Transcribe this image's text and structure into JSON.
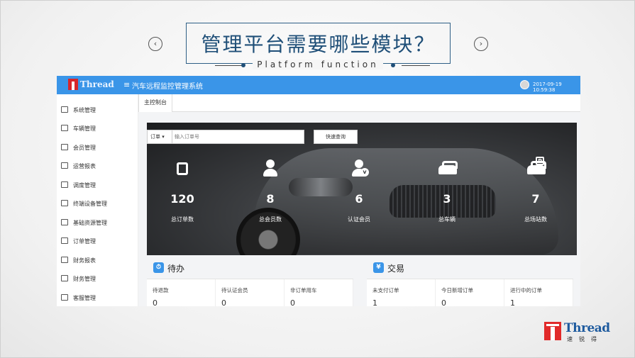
{
  "slide": {
    "title": "管理平台需要哪些模块？",
    "subtitle": "Platform function",
    "prev_arrow": "‹",
    "next_arrow": "›"
  },
  "app": {
    "logo_text": "Thread",
    "menu_icon": "≡",
    "title": "汽车远程监控管理系统",
    "datetime": "2017-09-19 10:59:38",
    "accent_color": "#3a95e8"
  },
  "sidebar": {
    "items": [
      {
        "label": "系统管理",
        "icon": "monitor-icon"
      },
      {
        "label": "车辆管理",
        "icon": "car-icon"
      },
      {
        "label": "会员管理",
        "icon": "users-icon"
      },
      {
        "label": "运营报表",
        "icon": "monitor-icon"
      },
      {
        "label": "调度管理",
        "icon": "grid-icon"
      },
      {
        "label": "终端设备管理",
        "icon": "device-icon"
      },
      {
        "label": "基础资源管理",
        "icon": "toolbox-icon"
      },
      {
        "label": "订单管理",
        "icon": "clipboard-icon"
      },
      {
        "label": "财务报表",
        "icon": "report-icon"
      },
      {
        "label": "财务管理",
        "icon": "money-icon"
      },
      {
        "label": "客服管理",
        "icon": "headset-icon"
      }
    ]
  },
  "tabs": [
    {
      "label": "主控制台"
    }
  ],
  "search": {
    "select_value": "订单",
    "placeholder": "输入订单号",
    "button_label": "快速查询"
  },
  "stats": [
    {
      "value": "120",
      "label": "总订单数",
      "icon": "order-phone-icon"
    },
    {
      "value": "8",
      "label": "总会员数",
      "icon": "member-icon"
    },
    {
      "value": "6",
      "label": "认证会员",
      "icon": "verified-member-icon"
    },
    {
      "value": "3",
      "label": "总车辆",
      "icon": "car-icon"
    },
    {
      "value": "7",
      "label": "总场站数",
      "icon": "parking-station-icon"
    }
  ],
  "panels": {
    "todo": {
      "icon": "⏱",
      "title": "待办",
      "cells": [
        {
          "label": "待退款",
          "value": "0"
        },
        {
          "label": "待认证会员",
          "value": "0"
        },
        {
          "label": "非订单用车",
          "value": "0"
        }
      ]
    },
    "trade": {
      "icon": "¥",
      "title": "交易",
      "cells": [
        {
          "label": "未支付订单",
          "value": "1"
        },
        {
          "label": "今日新增订单",
          "value": "0"
        },
        {
          "label": "进行中的订单",
          "value": "1"
        }
      ]
    }
  },
  "brand": {
    "word": "Thread",
    "chinese": "速锐得"
  }
}
